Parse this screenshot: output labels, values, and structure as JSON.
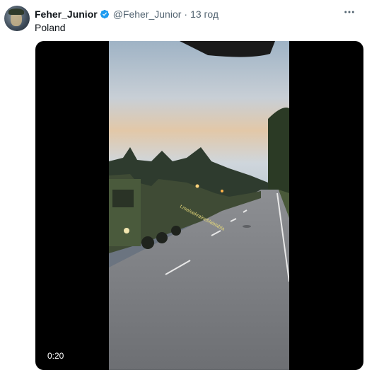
{
  "tweet": {
    "author_name": "Feher_Junior",
    "author_handle": "@Feher_Junior",
    "separator": "·",
    "time_ago": "13 год",
    "text": "Poland",
    "verified": true
  },
  "media": {
    "type": "video",
    "duration": "0:20",
    "watermark": "t.me/oekraineblablabla"
  },
  "colors": {
    "name": "#0f1419",
    "secondary": "#536471",
    "verified_badge": "#1d9bf0",
    "media_background": "#000000"
  },
  "icons": [
    "verified-badge-icon",
    "more-options-icon"
  ]
}
